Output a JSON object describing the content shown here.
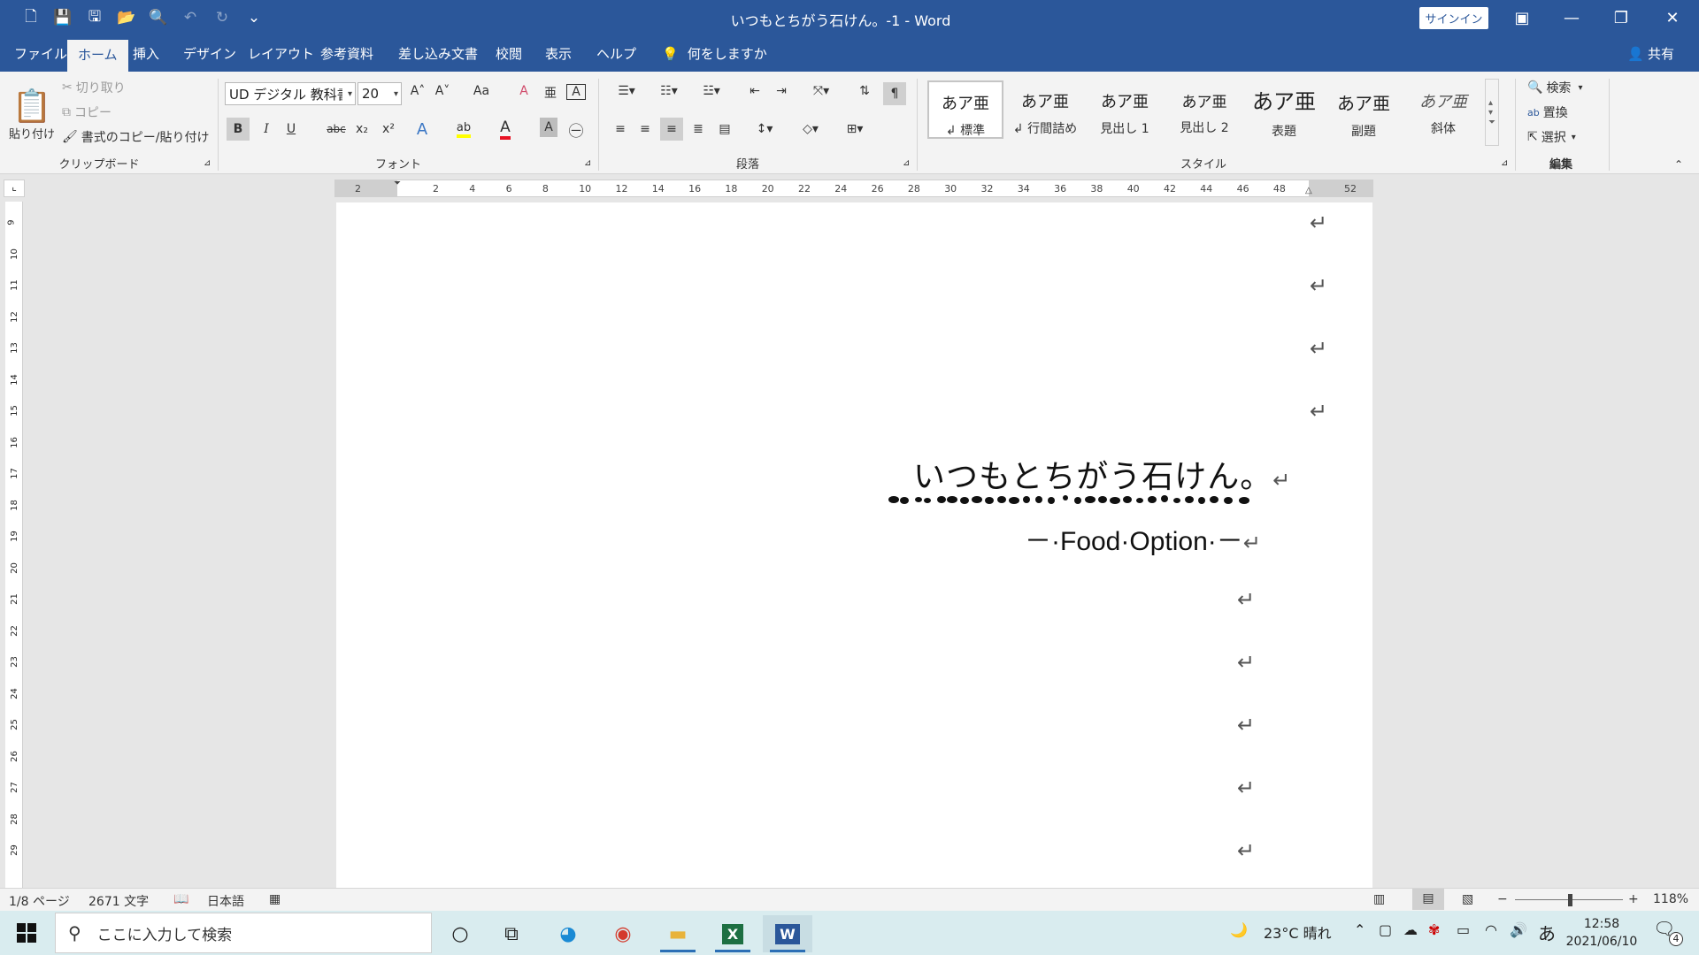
{
  "window": {
    "title": "いつもとちがう石けん。-1  -  Word",
    "signin": "サインイン",
    "minimize": "—",
    "restore": "❐",
    "close": "✕",
    "ribbon_display": "▣"
  },
  "qat": {
    "new": "🗋",
    "save": "💾",
    "save_as": "🖫",
    "open": "📂",
    "print_preview": "🔍",
    "undo": "↶",
    "redo": "↻",
    "customize": "⌄"
  },
  "tabs": [
    {
      "label": "ファイル"
    },
    {
      "label": "ホーム"
    },
    {
      "label": "挿入"
    },
    {
      "label": "デザイン"
    },
    {
      "label": "レイアウト"
    },
    {
      "label": "参考資料"
    },
    {
      "label": "差し込み文書"
    },
    {
      "label": "校閲"
    },
    {
      "label": "表示"
    },
    {
      "label": "ヘルプ"
    },
    {
      "label": "何をしますか"
    }
  ],
  "share": "共有",
  "clipboard": {
    "paste": "貼り付け",
    "cut": "切り取り",
    "copy": "コピー",
    "format_painter": "書式のコピー/貼り付け",
    "label": "クリップボード"
  },
  "font": {
    "name": "UD デジタル 教科書体",
    "size": "20",
    "label": "フォント",
    "bold": "B",
    "italic": "I",
    "underline": "U",
    "strike": "abc",
    "subscript": "x₂",
    "superscript": "x²",
    "grow": "A˄",
    "shrink": "A˅",
    "case": "Aa",
    "clear": "A",
    "phonetic": "亜",
    "border": "A",
    "effects": "A",
    "highlight": "ab",
    "color": "A",
    "shade": "A",
    "enclose": "㊀",
    "color_hex": "#e81123",
    "highlight_hex": "#ffff00"
  },
  "paragraph": {
    "label": "段落"
  },
  "styles": {
    "label": "スタイル",
    "items": [
      {
        "sample": "あア亜",
        "name": "↲ 標準"
      },
      {
        "sample": "あア亜",
        "name": "↲ 行間詰め"
      },
      {
        "sample": "あア亜",
        "name": "見出し 1"
      },
      {
        "sample": "あア亜",
        "name": "見出し 2"
      },
      {
        "sample": "あア亜",
        "name": "表題"
      },
      {
        "sample": "あア亜",
        "name": "副題"
      },
      {
        "sample": "あア亜",
        "name": "斜体"
      }
    ]
  },
  "editing": {
    "label": "編集",
    "find": "検索",
    "replace": "置換",
    "select": "選択"
  },
  "document": {
    "title_text": "いつもとちがう石けん。",
    "subtitle_text": "－·Food·Option·－",
    "return_mark": "↵"
  },
  "ruler": {
    "ticks": [
      "2",
      "2",
      "4",
      "6",
      "8",
      "10",
      "12",
      "14",
      "16",
      "18",
      "20",
      "22",
      "24",
      "26",
      "28",
      "30",
      "32",
      "34",
      "36",
      "38",
      "40",
      "42",
      "44",
      "46",
      "48",
      "52"
    ],
    "vticks": [
      "9",
      "10",
      "11",
      "12",
      "13",
      "14",
      "15",
      "16",
      "17",
      "18",
      "19",
      "20",
      "21",
      "22",
      "23",
      "24",
      "25",
      "26",
      "27",
      "28",
      "29"
    ]
  },
  "statusbar": {
    "page": "1/8 ページ",
    "words": "2671 文字",
    "language": "日本語",
    "zoom": "118%",
    "zoom_minus": "−",
    "zoom_plus": "+"
  },
  "taskbar": {
    "search_placeholder": "ここに入力して検索",
    "weather": "23°C  晴れ",
    "ime": "あ",
    "time": "12:58",
    "date": "2021/06/10",
    "notifications": "4"
  }
}
